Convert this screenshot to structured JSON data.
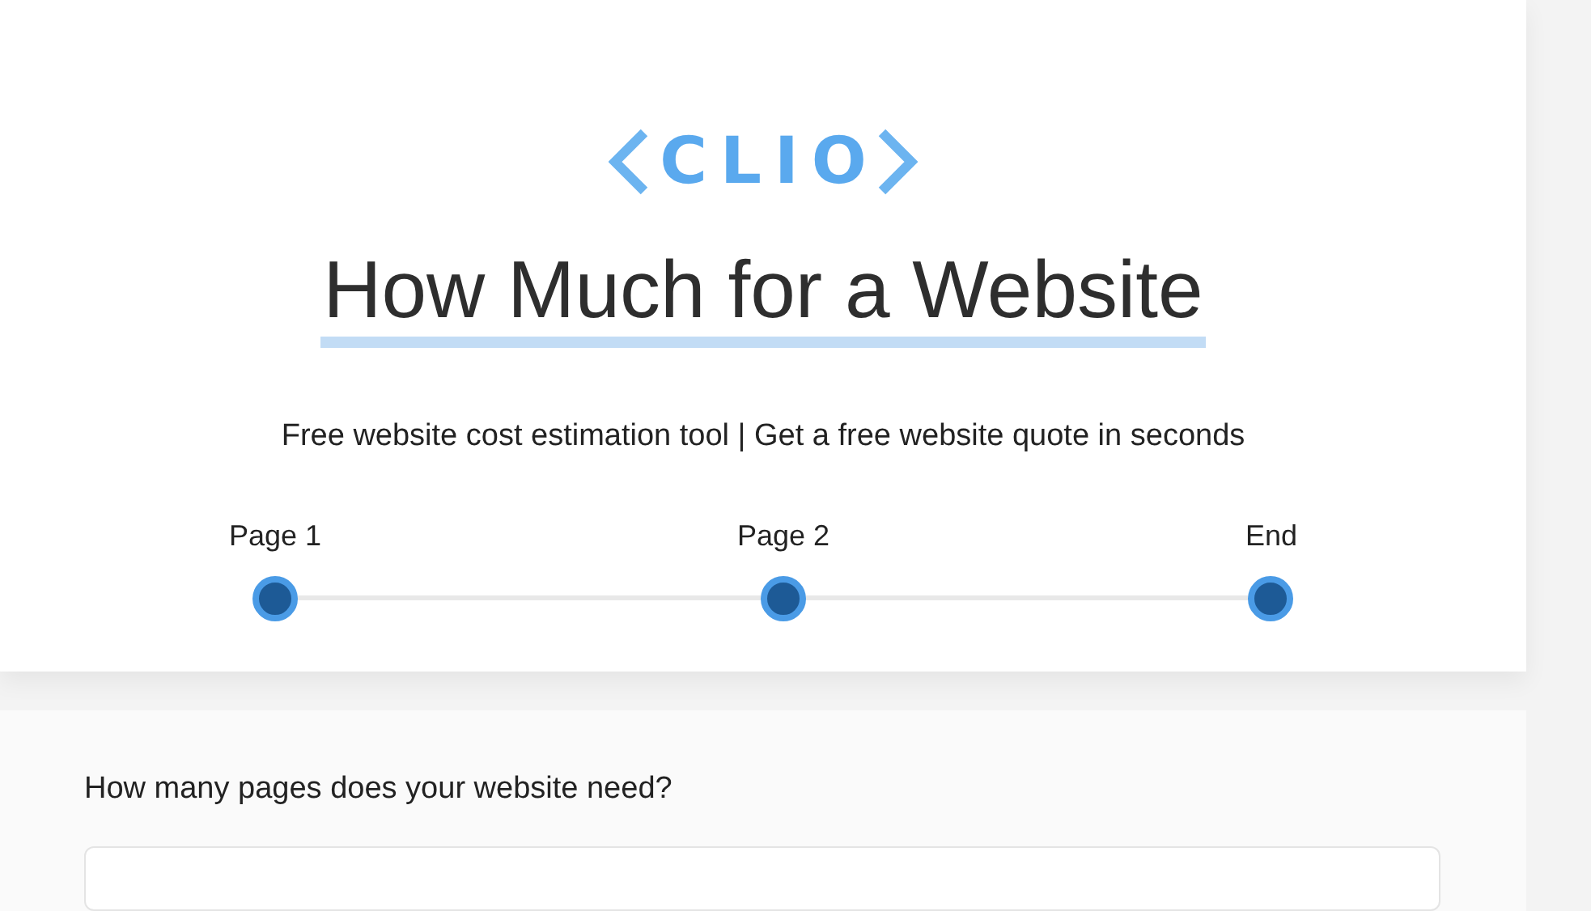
{
  "logo": {
    "text": "CLIO"
  },
  "header": {
    "title": "How Much for a Website",
    "subtitle": "Free website cost estimation tool | Get a free website quote in seconds"
  },
  "steps": [
    {
      "label": "Page 1"
    },
    {
      "label": "Page 2"
    },
    {
      "label": "End"
    }
  ],
  "question": {
    "label": "How many pages does your website need?"
  }
}
